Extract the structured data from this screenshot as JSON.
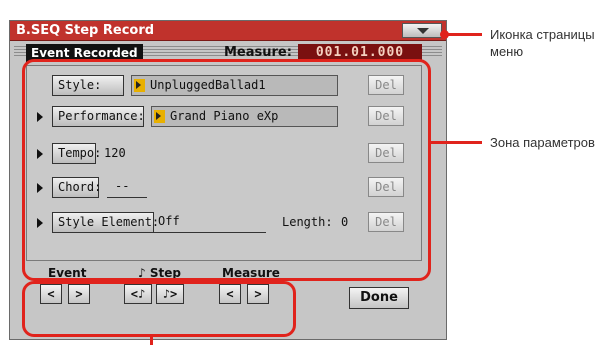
{
  "window": {
    "title": "B.SEQ Step Record"
  },
  "header": {
    "event_label": "Event Recorded",
    "measure_label": "Measure:",
    "measure_value": "001.01.000"
  },
  "params": {
    "style": {
      "label": "Style:",
      "value": "UnpluggedBallad1",
      "del": "Del"
    },
    "performance": {
      "label": "Performance:",
      "value": "Grand Piano eXp",
      "del": "Del"
    },
    "tempo": {
      "label": "Tempo:",
      "value": "120",
      "del": "Del"
    },
    "chord": {
      "label": "Chord:",
      "value": "--",
      "del": "Del"
    },
    "style_element": {
      "label": "Style Element:",
      "value": "Off",
      "length_label": "Length:",
      "length_value": "0",
      "del": "Del"
    }
  },
  "nav": {
    "event_label": "Event",
    "step_label": "♪ Step",
    "measure_label": "Measure",
    "prev": "<",
    "next": ">",
    "step_prev": "<♪",
    "step_next": "♪>"
  },
  "done_label": "Done",
  "callouts": {
    "menu_icon": "Иконка страницы меню",
    "param_area": "Зона параметров"
  },
  "colors": {
    "title_bar": "#c0322c",
    "measure_bg": "#7a1010",
    "highlight": "#e0231c",
    "screen_bg": "#c6c6c6"
  }
}
